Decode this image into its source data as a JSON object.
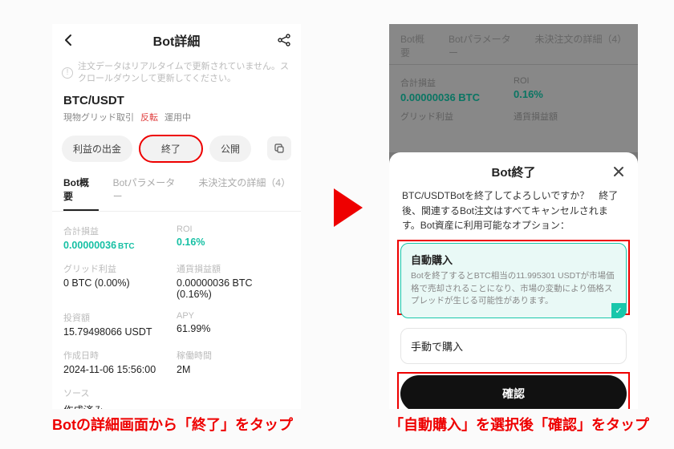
{
  "left": {
    "header_title": "Bot詳細",
    "info_text": "注文データはリアルタイムで更新されていません。スクロールダウンして更新してください。",
    "pair": "BTC/USDT",
    "chips": {
      "a": "現物グリッド取引",
      "b": "反転",
      "c": "運用中"
    },
    "buttons": {
      "withdraw": "利益の出金",
      "end": "終了",
      "publish": "公開"
    },
    "tabs": {
      "overview": "Bot概要",
      "params": "Botパラメーター",
      "pending": "未決注文の詳細（4）"
    },
    "stats": {
      "total_pl_lbl": "合計損益",
      "total_pl_val": "0.00000036",
      "total_pl_unit": "BTC",
      "roi_lbl": "ROI",
      "roi_val": "0.16%",
      "grid_lbl": "グリッド利益",
      "grid_val": "0 BTC (0.00%)",
      "quote_lbl": "通貨損益額",
      "quote_val": "0.00000036 BTC (0.16%)",
      "invest_lbl": "投資額",
      "invest_val": "15.79498066 USDT",
      "apy_lbl": "APY",
      "apy_val": "61.99%",
      "created_lbl": "作成日時",
      "created_val": "2024-11-06 15:56:00",
      "runtime_lbl": "稼働時間",
      "runtime_val": "2M",
      "source_lbl": "ソース",
      "source_val": "作成済み"
    }
  },
  "right": {
    "tabs": {
      "overview": "Bot概要",
      "params": "Botパラメーター",
      "pending": "未決注文の詳細（4）"
    },
    "dim": {
      "total_pl_lbl": "合計損益",
      "total_pl_val": "0.00000036 BTC",
      "roi_lbl": "ROI",
      "roi_val": "0.16%",
      "grid_lbl": "グリッド利益",
      "quote_lbl": "通貨損益額"
    },
    "sheet": {
      "title": "Bot終了",
      "message": "BTC/USDTBotを終了してよろしいですか？　終了後、関連するBot注文はすべてキャンセルされます。Bot資産に利用可能なオプション：",
      "auto_title": "自動購入",
      "auto_desc": "Botを終了するとBTC相当の11.995301 USDTが市場価格で売却されることになり、市場の変動により価格スプレッドが生じる可能性があります。",
      "manual_title": "手動で購入",
      "confirm": "確認"
    }
  },
  "captions": {
    "left": "Botの詳細画面から「終了」をタップ",
    "right": "「自動購入」を選択後「確認」をタップ"
  }
}
